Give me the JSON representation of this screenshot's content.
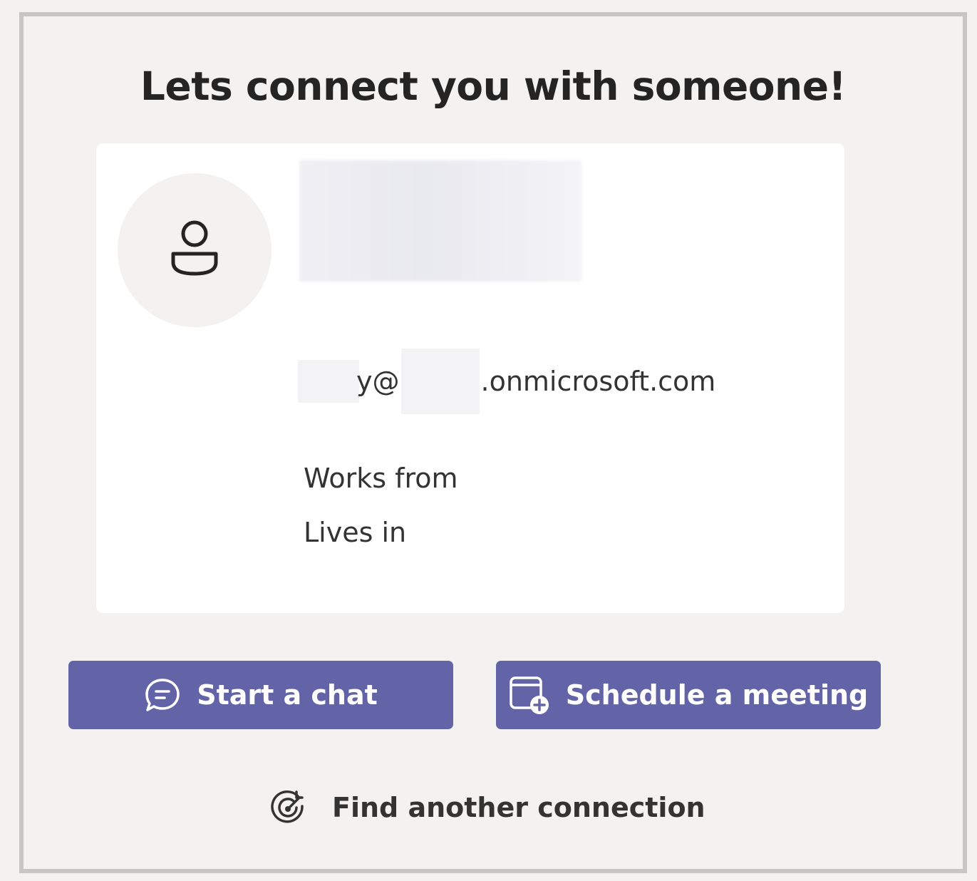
{
  "header": {
    "title": "Lets connect you with someone!"
  },
  "profile": {
    "email_partial_1": "y@",
    "email_domain": ".onmicrosoft.com",
    "works_from_label": "Works from",
    "lives_in_label": "Lives in"
  },
  "actions": {
    "start_chat_label": "Start a chat",
    "schedule_meeting_label": "Schedule a meeting",
    "find_another_label": "Find another connection"
  },
  "icons": {
    "avatar": "person-icon",
    "chat": "chat-bubble-icon",
    "meeting": "calendar-add-icon",
    "find": "target-refresh-icon"
  },
  "colors": {
    "accent": "#6264a7",
    "background": "#f3f2f1",
    "card": "#ffffff",
    "text": "#242424"
  }
}
